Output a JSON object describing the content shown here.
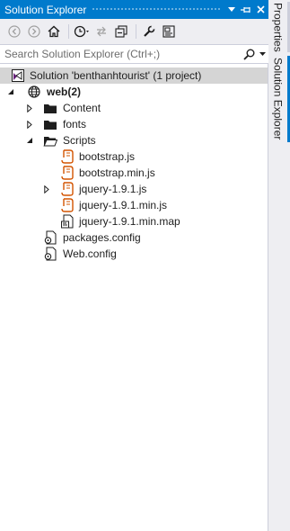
{
  "window": {
    "title": "Solution Explorer",
    "buttons": [
      "window-position-dropdown",
      "auto-hide-pin",
      "close"
    ]
  },
  "toolbar": {
    "icons": [
      "back-icon",
      "forward-icon",
      "home-icon",
      "history-icon",
      "sync-icon",
      "collapse-all-icon",
      "properties-wrench-icon",
      "preview-icon"
    ]
  },
  "search": {
    "placeholder": "Search Solution Explorer (Ctrl+;)",
    "icon": "search-icon"
  },
  "tree": {
    "solution": "Solution 'benthanhtourist' (1 project)",
    "project": "web(2)",
    "items": {
      "content": "Content",
      "fonts": "fonts",
      "scripts": "Scripts",
      "bootstrap": "bootstrap.js",
      "bootstrap_min": "bootstrap.min.js",
      "jquery": "jquery-1.9.1.js",
      "jquery_min": "jquery-1.9.1.min.js",
      "jquery_map": "jquery-1.9.1.min.map",
      "packages": "packages.config",
      "webconfig": "Web.config"
    }
  },
  "sidetabs": {
    "properties": "Properties",
    "solution_explorer": "Solution Explorer"
  },
  "colors": {
    "accent": "#007acc",
    "toolbar_bg": "#eeeef2",
    "selection": "#d5d5d5",
    "js_file": "#d35400",
    "folder": "#1e1e1e"
  }
}
